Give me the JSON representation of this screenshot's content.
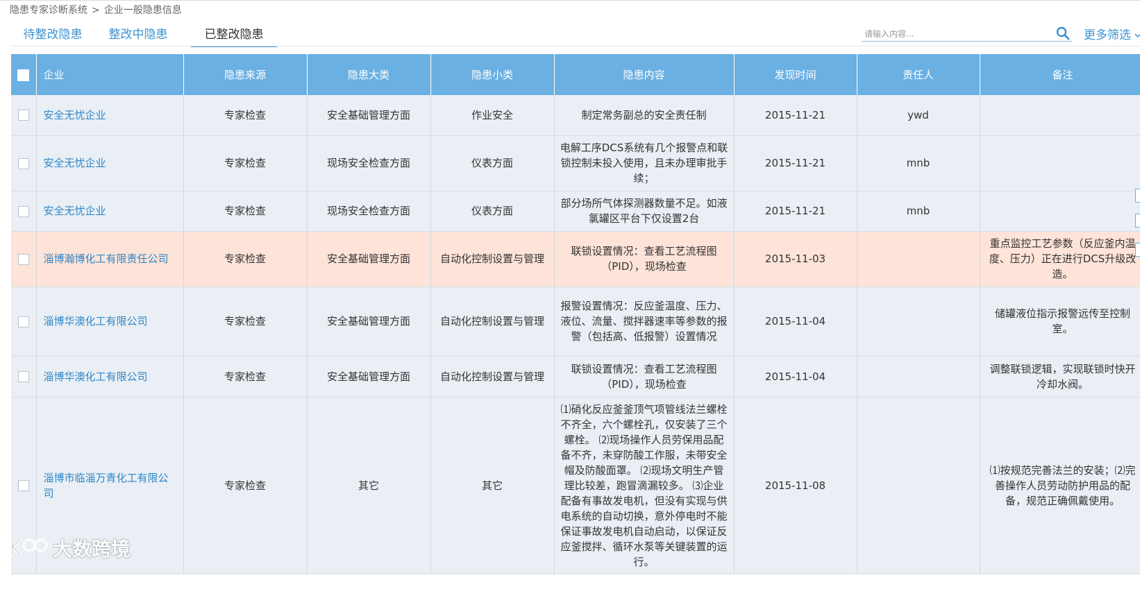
{
  "breadcrumb": {
    "system": "隐患专家诊断系统",
    "separator": ">",
    "current": "企业一般隐患信息"
  },
  "tabs": [
    {
      "label": "待整改隐患",
      "active": false
    },
    {
      "label": "整改中隐患",
      "active": false
    },
    {
      "label": "已整改隐患",
      "active": true
    }
  ],
  "search": {
    "placeholder": "请输入内容...",
    "value": ""
  },
  "more_filter": "更多筛选",
  "table": {
    "headers": {
      "company": "企业",
      "source": "隐患来源",
      "major": "隐患大类",
      "minor": "隐患小类",
      "content": "隐患内容",
      "date": "发现时间",
      "person": "责任人",
      "remark": "备注"
    },
    "rows": [
      {
        "company": "安全无忧企业",
        "source": "专家检查",
        "major": "安全基础管理方面",
        "minor": "作业安全",
        "content": "制定常务副总的安全责任制",
        "date": "2015-11-21",
        "person": "ywd",
        "remark": "",
        "highlight": false
      },
      {
        "company": "安全无忧企业",
        "source": "专家检查",
        "major": "现场安全检查方面",
        "minor": "仪表方面",
        "content": "电解工序DCS系统有几个报警点和联锁控制未投入使用，且未办理审批手续；",
        "date": "2015-11-21",
        "person": "mnb",
        "remark": "",
        "highlight": false
      },
      {
        "company": "安全无忧企业",
        "source": "专家检查",
        "major": "现场安全检查方面",
        "minor": "仪表方面",
        "content": "部分场所气体探测器数量不足。如液氯罐区平台下仅设置2台",
        "date": "2015-11-21",
        "person": "mnb",
        "remark": "",
        "highlight": false
      },
      {
        "company": "淄博瀚博化工有限责任公司",
        "source": "专家检查",
        "major": "安全基础管理方面",
        "minor": "自动化控制设置与管理",
        "content": "联锁设置情况：查看工艺流程图（PID），现场检查",
        "date": "2015-11-03",
        "person": "",
        "remark": "重点监控工艺参数（反应釜内温度、压力）正在进行DCS升级改造。",
        "highlight": true
      },
      {
        "company": "淄博华澳化工有限公司",
        "source": "专家检查",
        "major": "安全基础管理方面",
        "minor": "自动化控制设置与管理",
        "content": "报警设置情况：反应釜温度、压力、液位、流量、搅拌器速率等参数的报警（包括高、低报警）设置情况",
        "date": "2015-11-04",
        "person": "",
        "remark": "储罐液位指示报警远传至控制室。",
        "highlight": false
      },
      {
        "company": "淄博华澳化工有限公司",
        "source": "专家检查",
        "major": "安全基础管理方面",
        "minor": "自动化控制设置与管理",
        "content": "联锁设置情况：查看工艺流程图（PID），现场检查",
        "date": "2015-11-04",
        "person": "",
        "remark": "调整联锁逻辑，实现联锁时快开冷却水阀。",
        "highlight": false
      },
      {
        "company": "淄博市临淄万青化工有限公司",
        "source": "专家检查",
        "major": "其它",
        "minor": "其它",
        "content": "⑴硝化反应釜釜顶气项管线法兰螺栓不齐全，六个螺栓孔，仅安装了三个螺栓。 ⑵现场操作人员劳保用品配备不齐，未穿防酸工作服，未带安全帽及防酸面罩。 ⑵现场文明生产管理比较差，跑冒滴漏较多。 ⑶企业配备有事故发电机，但没有实现与供电系统的自动切换，意外停电时不能保证事故发电机自动启动，以保证反应釜搅拌、循环水泵等关键装置的运行。",
        "date": "2015-11-08",
        "person": "",
        "remark": "⑴按规范完善法兰的安装；⑵完善操作人员劳动防护用品的配备，规范正确佩戴使用。",
        "highlight": false
      }
    ]
  },
  "watermark": "大数跨境",
  "colors": {
    "header_bg": "#6ab0e2",
    "row_bg": "#e9eff4",
    "highlight_bg": "#fde3d8",
    "link": "#2f86c8"
  }
}
